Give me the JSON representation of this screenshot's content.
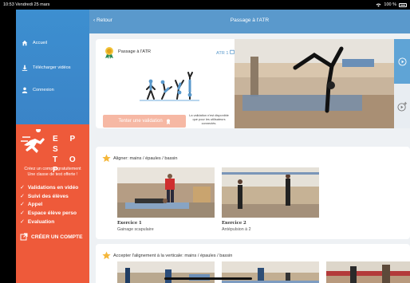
{
  "status_bar": {
    "time_date": "10:53  Vendredi 25 mars",
    "battery": "100 %"
  },
  "sidebar": {
    "items": [
      {
        "label": "Accueil",
        "icon": "home-icon"
      },
      {
        "label": "Télécharger vidéos",
        "icon": "download-icon"
      },
      {
        "label": "Connexion",
        "icon": "user-icon"
      }
    ]
  },
  "promo": {
    "logo_text": "EPS TOP",
    "logo_line1": "E P S",
    "logo_line2": "T O P",
    "description": "Créez un compte gratuitement\nUne classe de test offerte !",
    "features": [
      "Validations en vidéo",
      "Suivi des élèves",
      "Appel",
      "Espace élève perso",
      "Evaluation"
    ],
    "cta": "CRÉER UN COMPTE",
    "color": "#ee5a3a"
  },
  "header": {
    "back": "‹ Retour",
    "title": "Passage à l'ATR"
  },
  "hero": {
    "title": "Passage à l'ATR",
    "badge": "ATR 1",
    "try_button": "Tenter une validation",
    "note": "La validation n'est disponible que pour les utilisateurs connectés."
  },
  "sections": [
    {
      "title": "Aligner: mains / épaules / bassin",
      "exercises": [
        {
          "label": "Exercice 1",
          "sub": "Gainage scapulaire"
        },
        {
          "label": "Exercice 2",
          "sub": "Antépulsion à 2"
        }
      ]
    },
    {
      "title": "Accepter l'alignement à la verticale: mains / épaules / bassin"
    }
  ],
  "colors": {
    "accent": "#5a99cc",
    "sidebar": "#3a82c6",
    "promo": "#ee5a3a",
    "star": "#f5b73b"
  }
}
